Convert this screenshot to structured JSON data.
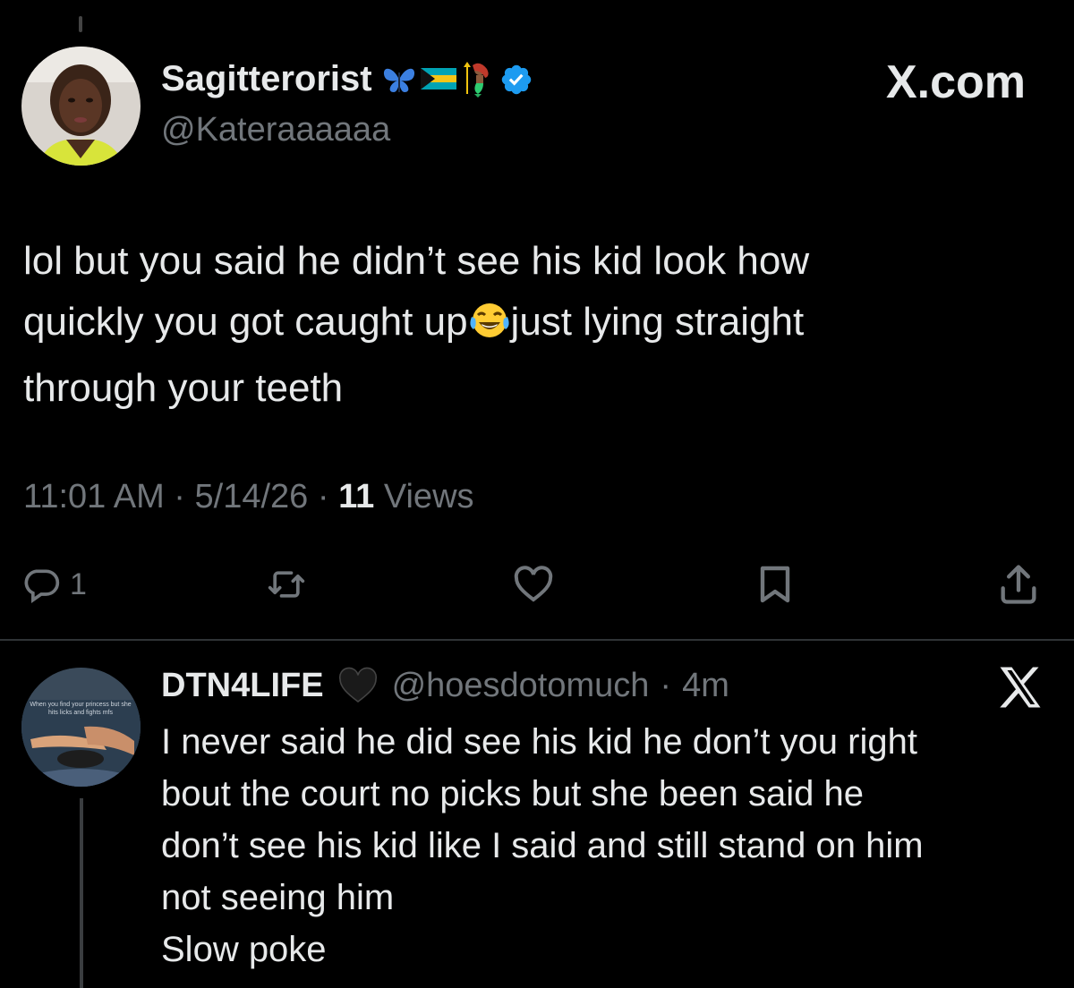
{
  "tweet": {
    "author": {
      "display_name": "Sagitterorist",
      "handle": "@Kateraaaaaa",
      "verified_icon": "verified-badge-icon",
      "name_emojis": [
        "butterfly-icon",
        "bahamas-flag-icon",
        "mermaid-icon"
      ]
    },
    "site_label": "X.com",
    "text_lines": [
      "lol but you said he didn’t see his kid look how",
      "quickly you got caught up",
      "just lying straight",
      "through your teeth"
    ],
    "meta": {
      "time": "11:01 AM",
      "sep1": "·",
      "date": "5/14/26",
      "sep2": "·",
      "views_count": "11",
      "views_label": "Views"
    },
    "actions": {
      "reply_count": "1"
    }
  },
  "reply": {
    "display_name": "DTN4LIFE",
    "handle": "@hoesdotomuch",
    "separator": "·",
    "age": "4m",
    "avatar_caption_1": "When you find your princess but she",
    "avatar_caption_2": "hits licks and fights mfs",
    "text_lines": [
      "I never said he did see his kid he don’t you right",
      "bout the court no picks but she been said he",
      "don’t see his kid like I said and still stand on him",
      "not seeing him",
      "Slow poke"
    ]
  },
  "colors": {
    "background": "#000000",
    "text": "#e7e9ea",
    "muted": "#71767b",
    "verified": "#1d9bf0",
    "divider": "#2f3336"
  }
}
